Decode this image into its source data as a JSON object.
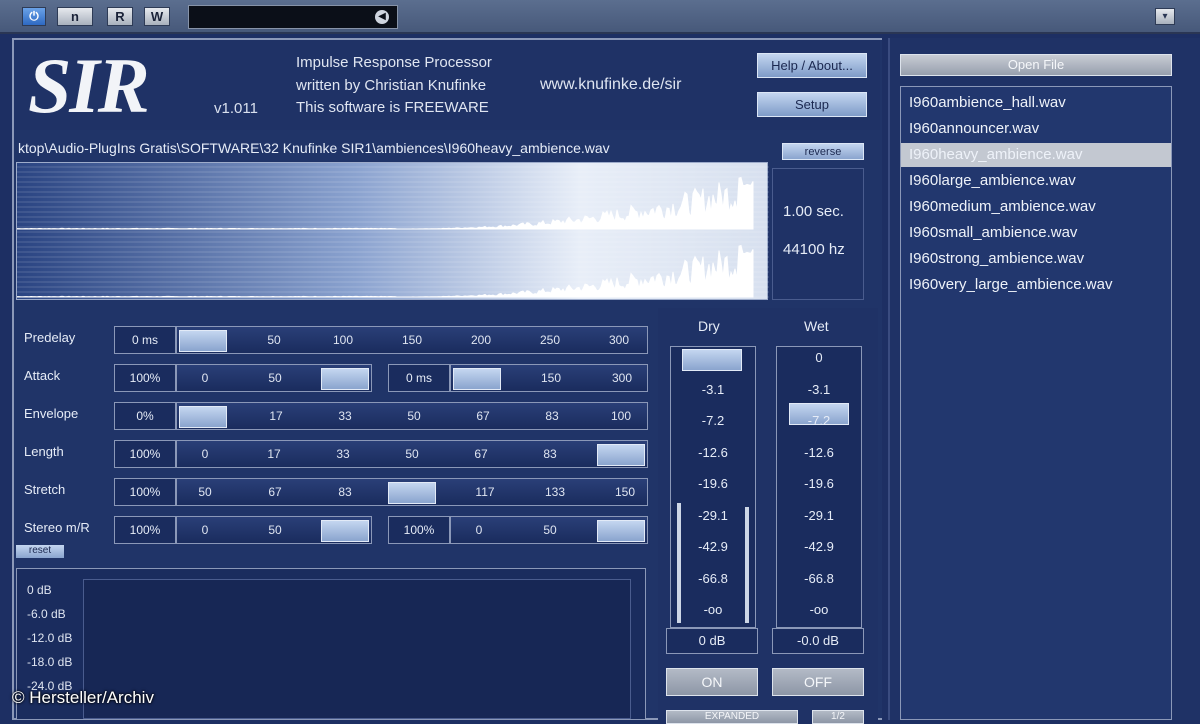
{
  "host": {
    "power_label": "⏻",
    "n_label": "n",
    "r_label": "R",
    "w_label": "W",
    "preset_value": "",
    "menu_glyph": "▾"
  },
  "header": {
    "logo": "SIR",
    "version": "v1.011",
    "info": [
      "Impulse Response Processor",
      "written by Christian Knufinke",
      "This software is FREEWARE"
    ],
    "website": "www.knufinke.de/sir",
    "help_label": "Help / About...",
    "setup_label": "Setup"
  },
  "waveform": {
    "file_path": "ktop\\Audio-PlugIns Gratis\\SOFTWARE\\32 Knufinke SIR1\\ambiences\\I960heavy_ambience.wav",
    "reverse_label": "reverse",
    "duration": "1.00 sec.",
    "sample_rate": "44100 hz"
  },
  "controls": {
    "reset_label": "reset",
    "rows": [
      {
        "label": "Predelay",
        "value": "0 ms",
        "ticks": [
          "50",
          "100",
          "150",
          "200",
          "250",
          "300"
        ],
        "level": 0.0
      },
      {
        "label": "Attack",
        "value": "100%",
        "ticks": [
          "0",
          "50"
        ],
        "level": 1.0,
        "value2": "0 ms",
        "ticks2": [
          "150",
          "300"
        ],
        "level2": 0.0
      },
      {
        "label": "Envelope",
        "value": "0%",
        "ticks": [
          "17",
          "33",
          "50",
          "67",
          "83",
          "100"
        ],
        "level": 0.0
      },
      {
        "label": "Length",
        "value": "100%",
        "ticks": [
          "0",
          "17",
          "33",
          "50",
          "67",
          "83"
        ],
        "level": 1.0
      },
      {
        "label": "Stretch",
        "value": "100%",
        "ticks": [
          "50",
          "67",
          "83",
          "117",
          "133",
          "150"
        ],
        "level": 0.5
      },
      {
        "label": "Stereo m/R",
        "value": "100%",
        "ticks": [
          "0",
          "50"
        ],
        "level": 1.0,
        "value2": "100%",
        "ticks2": [
          "0",
          "50"
        ],
        "level2": 1.0
      }
    ]
  },
  "meter": {
    "db_labels": [
      "0 dB",
      "-6.0 dB",
      "-12.0 dB",
      "-18.0 dB",
      "-24.0 dB"
    ]
  },
  "drywet": {
    "dry_title": "Dry",
    "wet_title": "Wet",
    "scale": [
      "0",
      "-3.1",
      "-7.2",
      "-12.6",
      "-19.6",
      "-29.1",
      "-42.9",
      "-66.8",
      "-oo"
    ],
    "dry_value": "0 dB",
    "wet_value": "-0.0 dB",
    "dry_level": 0.0,
    "wet_level": 0.15,
    "on_label": "ON",
    "off_label": "OFF",
    "partial_label1": "EXPANDED",
    "partial_label2": "1/2"
  },
  "browser": {
    "open_label": "Open File",
    "files": [
      "I960ambience_hall.wav",
      "I960announcer.wav",
      "I960heavy_ambience.wav",
      "I960large_ambience.wav",
      "I960medium_ambience.wav",
      "I960small_ambience.wav",
      "I960strong_ambience.wav",
      "I960very_large_ambience.wav"
    ],
    "selected_index": 2
  },
  "credit": "© Hersteller/Archiv"
}
